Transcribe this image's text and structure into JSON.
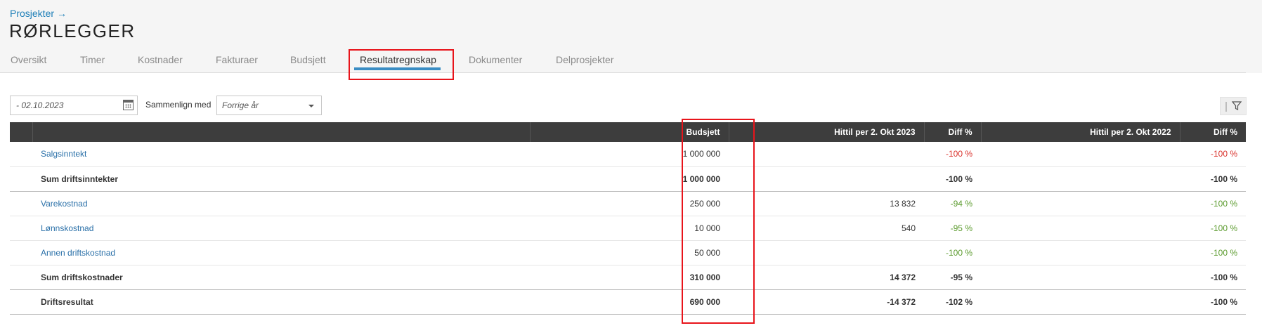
{
  "breadcrumb": {
    "label": "Prosjekter",
    "arrow": "→"
  },
  "page_title": "RØRLEGGER",
  "tabs": [
    {
      "label": "Oversikt",
      "active": false
    },
    {
      "label": "Timer",
      "active": false
    },
    {
      "label": "Kostnader",
      "active": false
    },
    {
      "label": "Fakturaer",
      "active": false
    },
    {
      "label": "Budsjett",
      "active": false
    },
    {
      "label": "Resultatregnskap",
      "active": true
    },
    {
      "label": "Dokumenter",
      "active": false
    },
    {
      "label": "Delprosjekter",
      "active": false
    }
  ],
  "filters": {
    "date_value": "- 02.10.2023",
    "compare_label": "Sammenlign med",
    "compare_value": "Forrige år"
  },
  "table": {
    "headers": [
      "",
      "",
      "Budsjett",
      "Hittil per 2. Okt 2023",
      "Diff %",
      "Hittil per 2. Okt 2022",
      "Diff %"
    ],
    "rows": [
      {
        "label": "Salgsinntekt",
        "budget": "1 000 000",
        "current": "",
        "diff1": "-100 %",
        "previous": "",
        "diff2": "-100 %"
      },
      {
        "label": "Sum driftsinntekter",
        "budget": "1 000 000",
        "current": "",
        "diff1": "-100 %",
        "previous": "",
        "diff2": "-100 %"
      },
      {
        "label": "Varekostnad",
        "budget": "250 000",
        "current": "13 832",
        "diff1": "-94 %",
        "previous": "",
        "diff2": "-100 %"
      },
      {
        "label": "Lønnskostnad",
        "budget": "10 000",
        "current": "540",
        "diff1": "-95 %",
        "previous": "",
        "diff2": "-100 %"
      },
      {
        "label": "Annen driftskostnad",
        "budget": "50 000",
        "current": "",
        "diff1": "-100 %",
        "previous": "",
        "diff2": "-100 %"
      },
      {
        "label": "Sum driftskostnader",
        "budget": "310 000",
        "current": "14 372",
        "diff1": "-95 %",
        "previous": "",
        "diff2": "-100 %"
      },
      {
        "label": "Driftsresultat",
        "budget": "690 000",
        "current": "-14 372",
        "diff1": "-102 %",
        "previous": "",
        "diff2": "-100 %"
      }
    ]
  },
  "colors": {
    "link": "#2a70a8",
    "negative": "#d9312b",
    "positive": "#5a9a2c",
    "header_bg": "#3d3d3d",
    "highlight": "#e8141b",
    "tab_accent": "#3a8dc4"
  },
  "icons": {
    "date_picker": "calendar-icon",
    "dropdown": "chevron-down-icon",
    "filter": "filter-icon"
  }
}
